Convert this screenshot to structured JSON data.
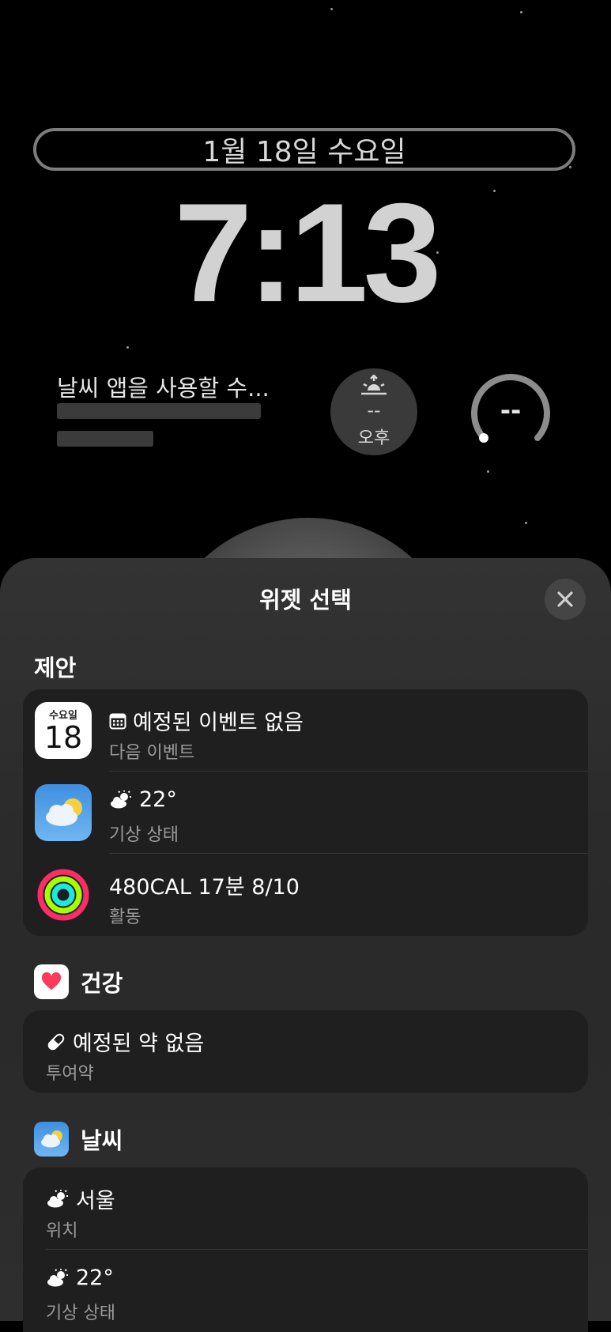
{
  "lock_screen": {
    "date": "1월 18일 수요일",
    "time": "7:13",
    "weather_widget_text": "날씨 앱을 사용할 수...",
    "sunset_widget": {
      "value": "--",
      "label": "오후"
    },
    "gauge_widget": {
      "value": "--"
    }
  },
  "sheet": {
    "title": "위젯 선택",
    "close_icon": "close-icon",
    "suggestions": {
      "title": "제안",
      "items": [
        {
          "icon": "calendar-app-icon",
          "calendar_day": "수요일",
          "calendar_date": "18",
          "title": "예정된 이벤트 없음",
          "subtitle": "다음 이벤트"
        },
        {
          "icon": "weather-app-icon",
          "title": "22°",
          "subtitle": "기상 상태"
        },
        {
          "icon": "activity-rings-icon",
          "title": "480CAL 17분 8/10",
          "subtitle": "활동"
        }
      ]
    },
    "health": {
      "title": "건강",
      "items": [
        {
          "icon": "pill-icon",
          "title": "예정된 약 없음",
          "subtitle": "투여약"
        }
      ]
    },
    "weather": {
      "title": "날씨",
      "items": [
        {
          "icon": "partly-cloudy-icon",
          "title": "서울",
          "subtitle": "위치"
        },
        {
          "icon": "partly-cloudy-icon",
          "title": "22°",
          "subtitle": "기상 상태"
        }
      ]
    }
  }
}
